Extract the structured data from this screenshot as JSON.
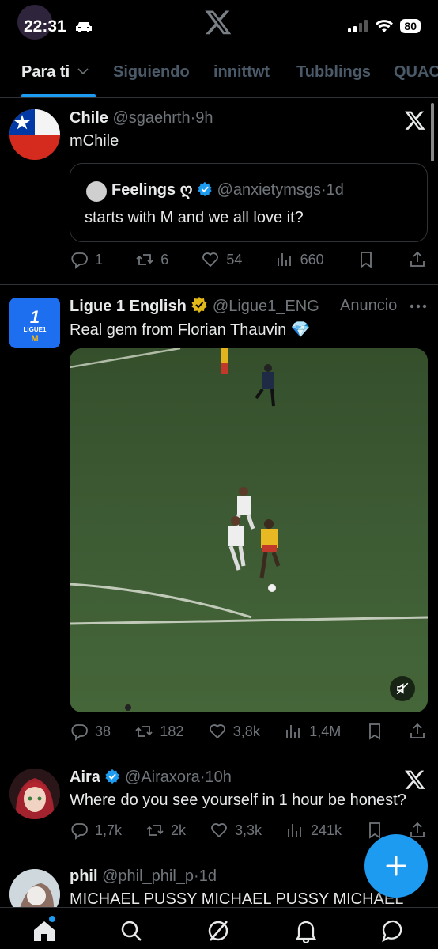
{
  "status_bar": {
    "time": "22:31",
    "battery": "80"
  },
  "tabs": [
    {
      "label": "Para ti"
    },
    {
      "label": "Siguiendo"
    },
    {
      "label": "innittwt"
    },
    {
      "label": "Tubblings"
    },
    {
      "label": "QUAC"
    }
  ],
  "posts": [
    {
      "name": "Chile",
      "handle": "@sgaehrth",
      "time": "9h",
      "text": "mChile",
      "quote": {
        "name": "Feelings ღ",
        "handle": "@anxietymsgs",
        "time": "1d",
        "text": "starts with M and we all love it?"
      },
      "replies": "1",
      "reposts": "6",
      "likes": "54",
      "views": "660"
    },
    {
      "name": "Ligue 1 English",
      "handle": "@Ligue1_ENG",
      "ad_label": "Anuncio",
      "text": "Real gem from Florian Thauvin 💎",
      "avatar_text": "LIGUE1",
      "replies": "38",
      "reposts": "182",
      "likes": "3,8k",
      "views": "1,4M"
    },
    {
      "name": "Aira",
      "handle": "@Airaxora",
      "time": "10h",
      "text": "Where do you see yourself in 1 hour be honest?",
      "replies": "1,7k",
      "reposts": "2k",
      "likes": "3,3k",
      "views": "241k"
    },
    {
      "name": "phil",
      "handle": "@phil_phil_p",
      "time": "1d",
      "text": "MICHAEL PUSSY MICHAEL PUSSY MICHAEL"
    }
  ],
  "separator": "·",
  "colors": {
    "accent": "#1d9bf0",
    "background": "#000000",
    "muted": "#71767b",
    "verified_gold": "#e2b719"
  }
}
